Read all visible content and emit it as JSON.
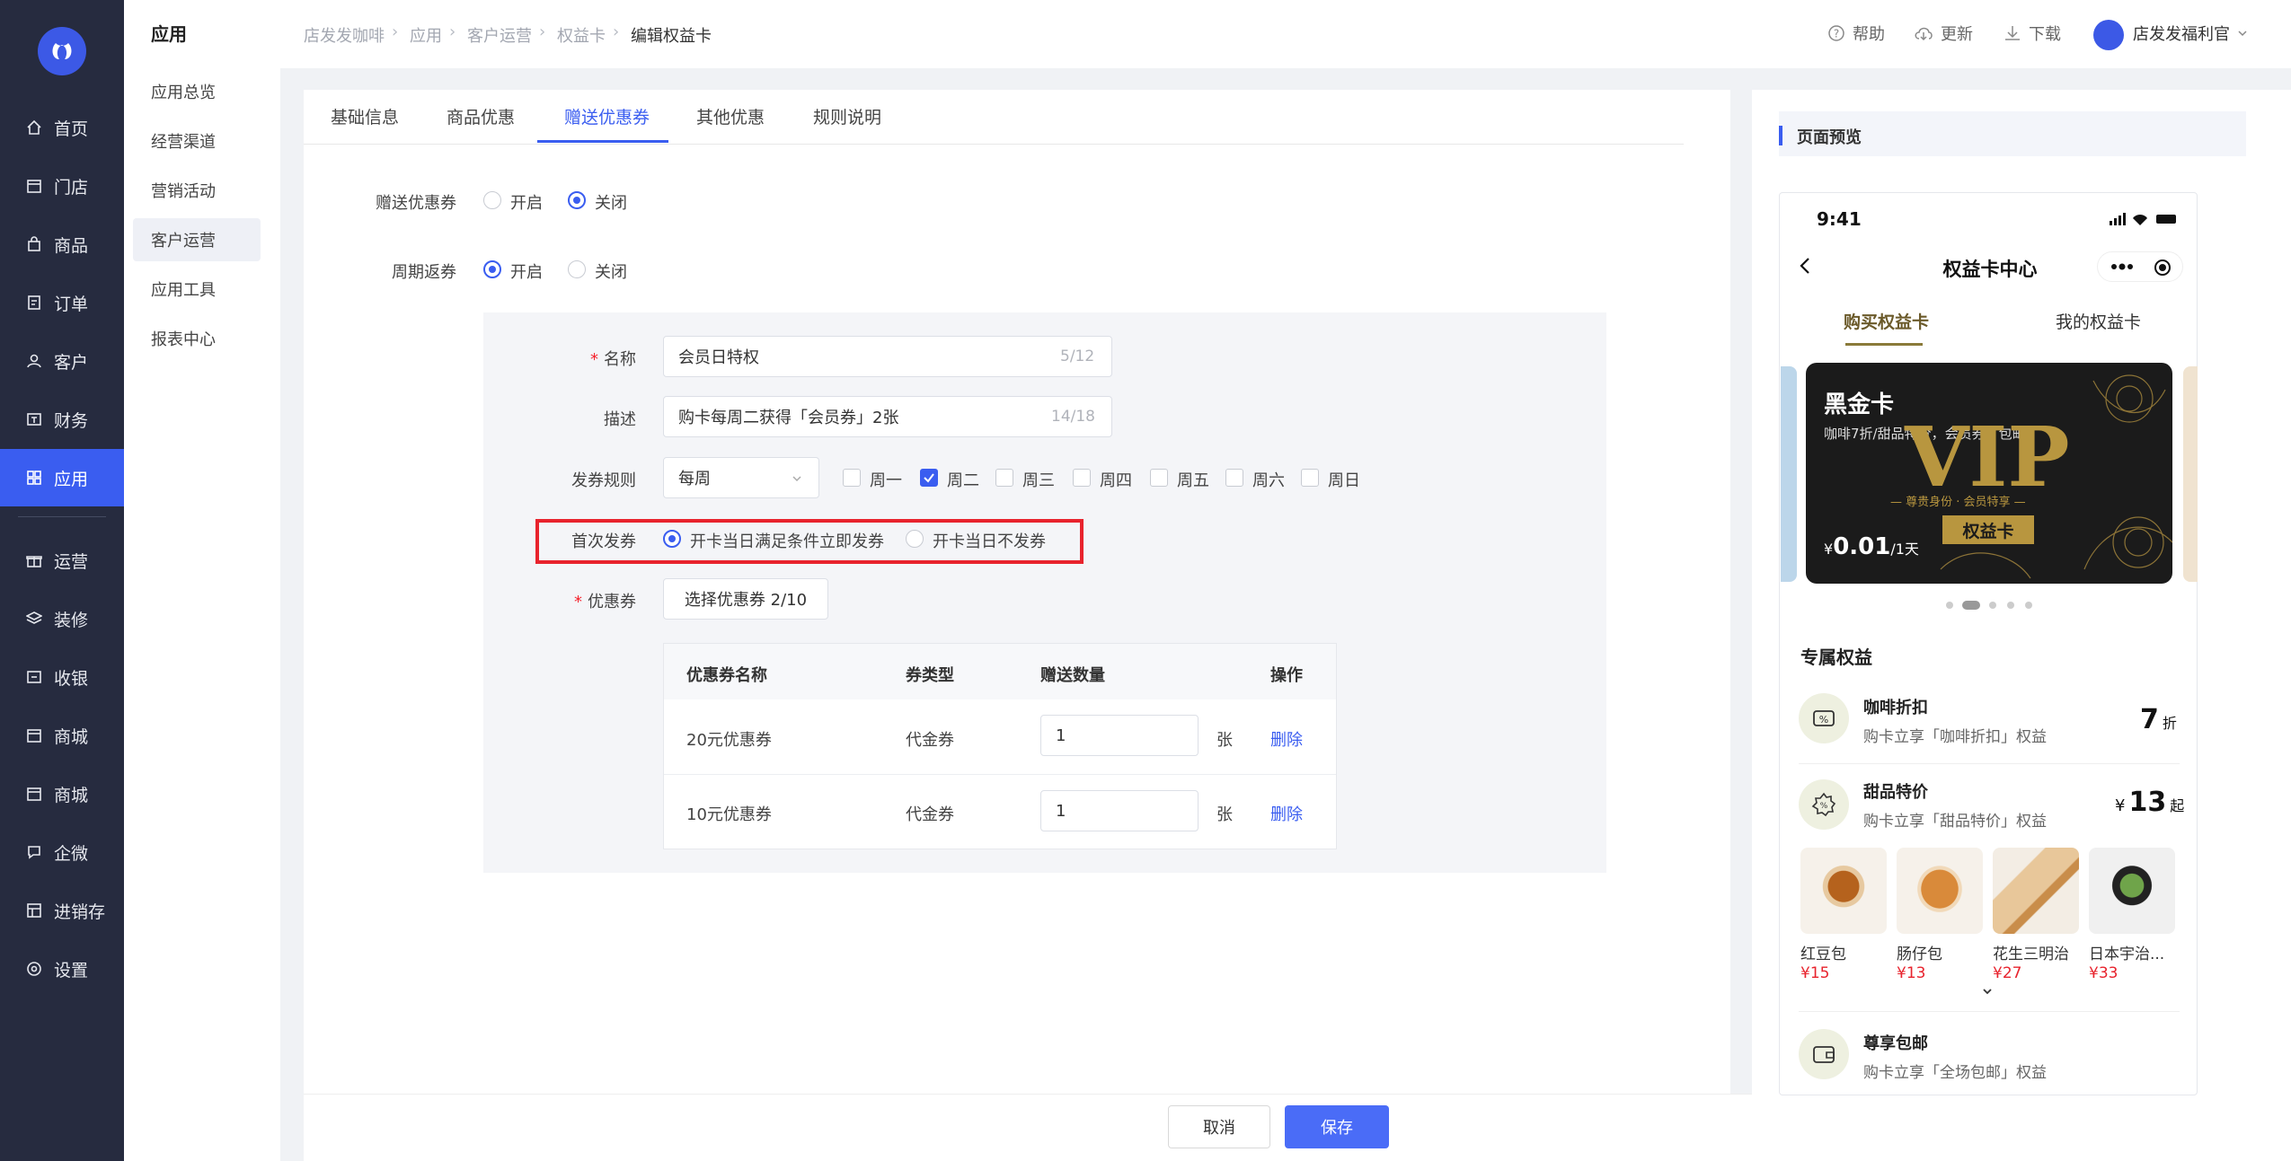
{
  "sidebar": {
    "items": [
      {
        "label": "首页",
        "icon": "home-icon"
      },
      {
        "label": "门店",
        "icon": "store-icon"
      },
      {
        "label": "商品",
        "icon": "bag-icon"
      },
      {
        "label": "订单",
        "icon": "order-icon"
      },
      {
        "label": "客户",
        "icon": "user-icon"
      },
      {
        "label": "财务",
        "icon": "finance-icon"
      },
      {
        "label": "应用",
        "icon": "apps-icon"
      },
      {
        "label": "运营",
        "icon": "gift-icon"
      },
      {
        "label": "装修",
        "icon": "layers-icon"
      },
      {
        "label": "收银",
        "icon": "cashier-icon"
      },
      {
        "label": "商城",
        "icon": "mall-icon"
      },
      {
        "label": "商城",
        "icon": "mall-icon"
      },
      {
        "label": "企微",
        "icon": "chat-icon"
      },
      {
        "label": "进销存",
        "icon": "inventory-icon"
      },
      {
        "label": "设置",
        "icon": "settings-icon"
      }
    ],
    "active_index": 6,
    "accent": "#3a5df0",
    "background": "#262b3f"
  },
  "subnav": {
    "title": "应用",
    "items": [
      "应用总览",
      "经营渠道",
      "营销活动",
      "客户运营",
      "应用工具",
      "报表中心"
    ],
    "active_index": 3
  },
  "topbar": {
    "breadcrumb": [
      "店发发咖啡",
      "应用",
      "客户运营",
      "权益卡",
      "编辑权益卡"
    ],
    "help": "帮助",
    "update": "更新",
    "download": "下载",
    "user_name": "店发发福利官"
  },
  "tabs": [
    "基础信息",
    "商品优惠",
    "赠送优惠券",
    "其他优惠",
    "规则说明"
  ],
  "active_tab": 2,
  "form": {
    "gift_coupon": {
      "label": "赠送优惠券",
      "options": [
        "开启",
        "关闭"
      ],
      "selected": "关闭"
    },
    "cycle_coupon": {
      "label": "周期返券",
      "options": [
        "开启",
        "关闭"
      ],
      "selected": "开启"
    },
    "name": {
      "label": "名称",
      "value": "会员日特权",
      "counter": "5/12"
    },
    "desc": {
      "label": "描述",
      "value": "购卡每周二获得「会员券」2张",
      "counter": "14/18"
    },
    "rule": {
      "label": "发券规则",
      "frequency": "每周",
      "days": [
        "周一",
        "周二",
        "周三",
        "周四",
        "周五",
        "周六",
        "周日"
      ],
      "checked": [
        "周二"
      ]
    },
    "first_issue": {
      "label": "首次发券",
      "options": [
        "开卡当日满足条件立即发券",
        "开卡当日不发券"
      ],
      "selected": "开卡当日满足条件立即发券"
    },
    "coupon": {
      "label": "优惠券",
      "button": "选择优惠券 2/10"
    },
    "table": {
      "headers": [
        "优惠券名称",
        "券类型",
        "赠送数量",
        "操作"
      ],
      "rows": [
        {
          "name": "20元优惠券",
          "type": "代金券",
          "qty": "1",
          "unit": "张",
          "action": "删除"
        },
        {
          "name": "10元优惠券",
          "type": "代金券",
          "qty": "1",
          "unit": "张",
          "action": "删除"
        }
      ]
    }
  },
  "footer": {
    "cancel": "取消",
    "save": "保存"
  },
  "preview": {
    "title": "页面预览",
    "status_time": "9:41",
    "page_title": "权益卡中心",
    "tabs": [
      "购买权益卡",
      "我的权益卡"
    ],
    "card": {
      "name": "黑金卡",
      "desc": "咖啡7折/甜品特价，会员券，包邮",
      "big": "VIP",
      "tagline": "— 尊贵身份 · 会员特享 —",
      "badge": "权益卡",
      "price_symbol": "¥",
      "price": "0.01",
      "period": "/1天"
    },
    "section_title": "专属权益",
    "benefits": [
      {
        "title": "咖啡折扣",
        "desc": "购卡立享「咖啡折扣」权益",
        "value": "7",
        "suffix": "折",
        "prefix": ""
      },
      {
        "title": "甜品特价",
        "desc": "购卡立享「甜品特价」权益",
        "value": "13",
        "suffix": "起",
        "prefix": "¥"
      },
      {
        "title": "尊享包邮",
        "desc": "购卡立享「全场包邮」权益"
      }
    ],
    "products": [
      {
        "name": "红豆包",
        "price": "¥15"
      },
      {
        "name": "肠仔包",
        "price": "¥13"
      },
      {
        "name": "花生三明治",
        "price": "¥27"
      },
      {
        "name": "日本宇治...",
        "price": "¥33"
      }
    ]
  }
}
